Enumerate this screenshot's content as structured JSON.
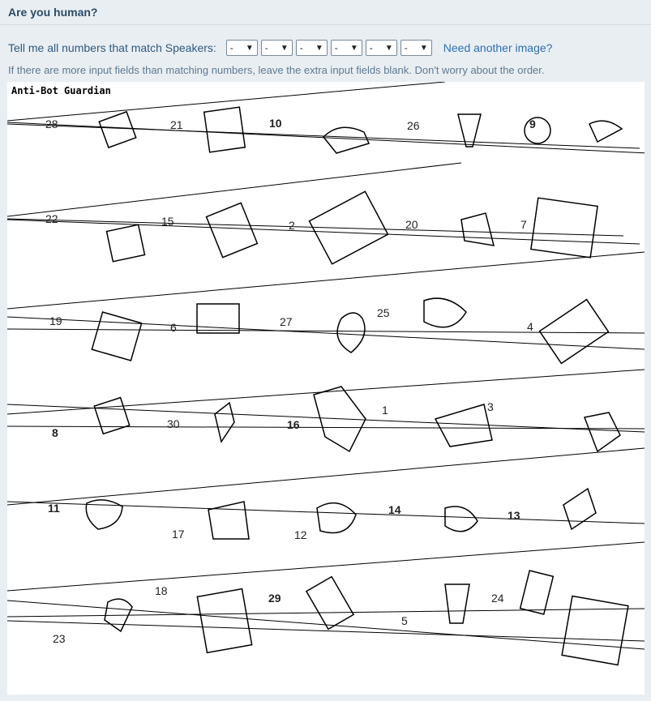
{
  "header": {
    "title": "Are you human?"
  },
  "prompt": {
    "text": "Tell me all numbers that match Speakers:",
    "selects": [
      "-",
      "-",
      "-",
      "-",
      "-",
      "-"
    ],
    "link": "Need another image?",
    "hint": "If there are more input fields than matching numbers, leave the extra input fields blank. Don't worry about the order."
  },
  "captcha": {
    "title": "Anti-Bot Guardian",
    "numbers": [
      "28",
      "21",
      "10",
      "26",
      "9",
      "22",
      "15",
      "2",
      "20",
      "7",
      "19",
      "6",
      "27",
      "25",
      "4",
      "8",
      "30",
      "16",
      "1",
      "3",
      "11",
      "17",
      "12",
      "14",
      "13",
      "18",
      "29",
      "5",
      "24",
      "23"
    ]
  }
}
